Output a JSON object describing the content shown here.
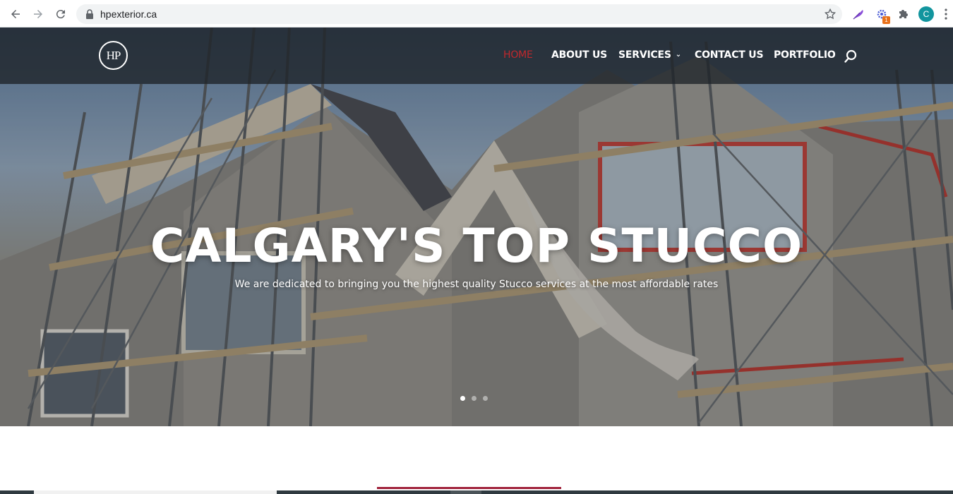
{
  "browser": {
    "url": "hpexterior.ca",
    "extension_badge": "1",
    "profile_initial": "C",
    "icons": [
      "back-icon",
      "forward-icon",
      "reload-icon",
      "lock-icon",
      "star-icon",
      "feather-extension-icon",
      "gear-extension-icon",
      "puzzle-icon",
      "menu-dots-icon"
    ]
  },
  "site": {
    "logo_text": "HP",
    "nav": [
      {
        "label": "HOME",
        "active": true
      },
      {
        "label": "ABOUT US",
        "active": false
      },
      {
        "label": "SERVICES",
        "active": false,
        "has_dropdown": true
      },
      {
        "label": "CONTACT US",
        "active": false
      },
      {
        "label": "PORTFOLIO",
        "active": false
      }
    ],
    "hero": {
      "title": "CALGARY'S TOP STUCCO",
      "subtitle": "We are dedicated to bringing you the highest quality Stucco services at the most affordable rates",
      "slides": 3,
      "active_slide": 1
    }
  },
  "colors": {
    "accent": "#c0282d",
    "header_bg": "#1e2228",
    "footer_accent": "#a0213a"
  }
}
